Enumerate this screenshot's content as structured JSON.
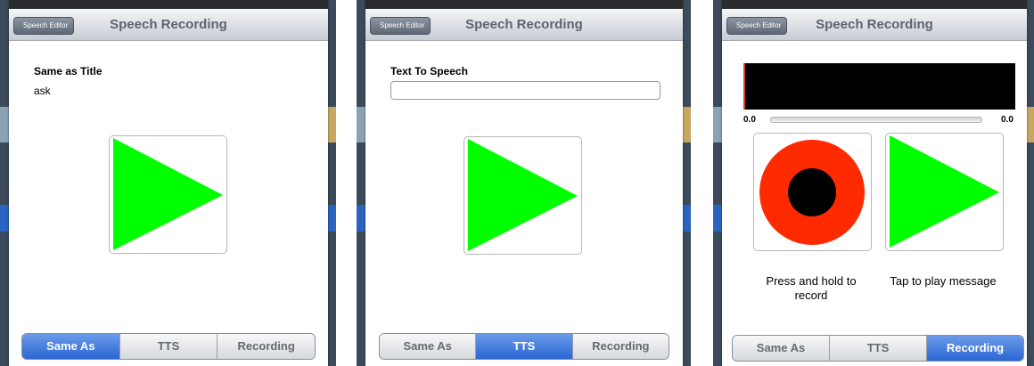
{
  "colors": {
    "play_green": "#00ff00",
    "record_red": "#ff2a00",
    "segment_active": "#2a66d4"
  },
  "screens": [
    {
      "back_label": "Speech Editor",
      "title": "Speech Recording",
      "field_label": "Same as Title",
      "field_value": "ask",
      "segments": [
        "Same As",
        "TTS",
        "Recording"
      ],
      "active_segment": "Same As"
    },
    {
      "back_label": "Speech Editor",
      "title": "Speech Recording",
      "field_label": "Text To Speech",
      "input_value": "",
      "segments": [
        "Same As",
        "TTS",
        "Recording"
      ],
      "active_segment": "TTS"
    },
    {
      "back_label": "Speech Editor",
      "title": "Speech Recording",
      "time_start": "0.0",
      "time_end": "0.0",
      "record_caption": "Press and hold to record",
      "play_caption": "Tap to play message",
      "segments": [
        "Same As",
        "TTS",
        "Recording"
      ],
      "active_segment": "Recording"
    }
  ],
  "icons": {
    "play": "play-icon",
    "record": "record-icon",
    "back": "chevron-left-icon"
  }
}
